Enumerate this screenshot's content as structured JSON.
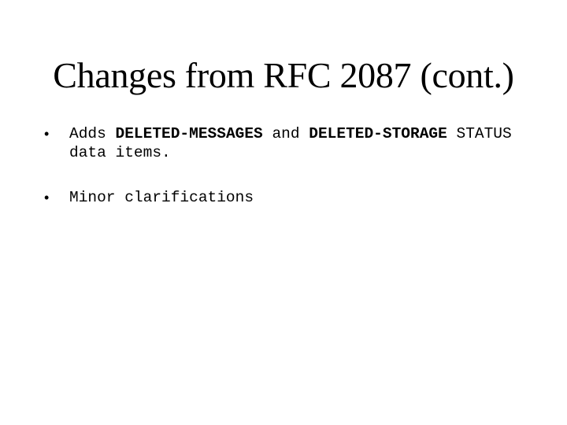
{
  "slide": {
    "title": "Changes from RFC 2087 (cont.)",
    "bullets": [
      {
        "marker": "•",
        "parts": {
          "p1": "Adds ",
          "p2": "DELETED-MESSAGES",
          "p3": " and ",
          "p4": "DELETED-STORAGE",
          "p5": " STATUS data items."
        }
      },
      {
        "marker": "•",
        "text": "Minor clarifications"
      }
    ]
  }
}
